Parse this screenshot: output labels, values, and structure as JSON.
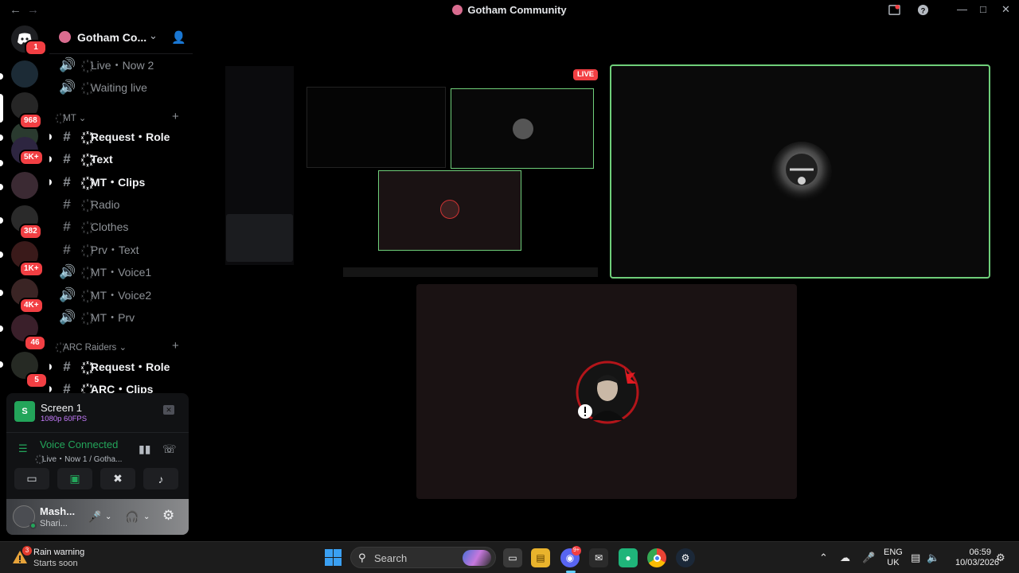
{
  "window": {
    "title": "Gotham Community"
  },
  "rail": {
    "home_badge": "1",
    "badges": [
      "968",
      "5K+",
      "382",
      "1K+",
      "4K+",
      "46",
      "5"
    ]
  },
  "server": {
    "name": "Gotham Co..."
  },
  "channels": {
    "top": [
      {
        "name": "꙰ Live・Now 2"
      },
      {
        "name": "꙰ Waiting live"
      }
    ],
    "cat_mt": "꙰ MT",
    "mt": [
      {
        "name": "꙰ Request・Role"
      },
      {
        "name": "꙰ Text"
      },
      {
        "name": "꙰ MT・Clips"
      },
      {
        "name": "꙰ Radio"
      },
      {
        "name": "꙰ Clothes"
      },
      {
        "name": "꙰ Prv・Text"
      },
      {
        "name": "꙰ MT・Voice1"
      },
      {
        "name": "꙰ MT・Voice2"
      },
      {
        "name": "꙰ MT・Prv"
      }
    ],
    "cat_arc": "꙰ ARC Raiders",
    "arc": [
      {
        "name": "꙰ Request・Role"
      },
      {
        "name": "꙰ ARC・Clips"
      }
    ]
  },
  "voice": {
    "screen_title": "Screen 1",
    "screen_quality": "1080p 60FPS",
    "status": "Voice Connected",
    "location": "꙰ Live・Now 1 / Gotha..."
  },
  "user": {
    "name": "Mash...",
    "status": "Shari..."
  },
  "stage": {
    "live_label": "LIVE"
  },
  "taskbar": {
    "weather_badge": "3",
    "weather_title": "Rain warning",
    "weather_sub": "Starts soon",
    "search_placeholder": "Search",
    "discord_badge": "9+",
    "lang_line1": "ENG",
    "lang_line2": "UK",
    "time": "06:59",
    "date": "10/03/2026"
  },
  "colors": {
    "accent_green": "#23a55a",
    "badge_red": "#f23f43",
    "stage_border": "#6fcf7a"
  }
}
